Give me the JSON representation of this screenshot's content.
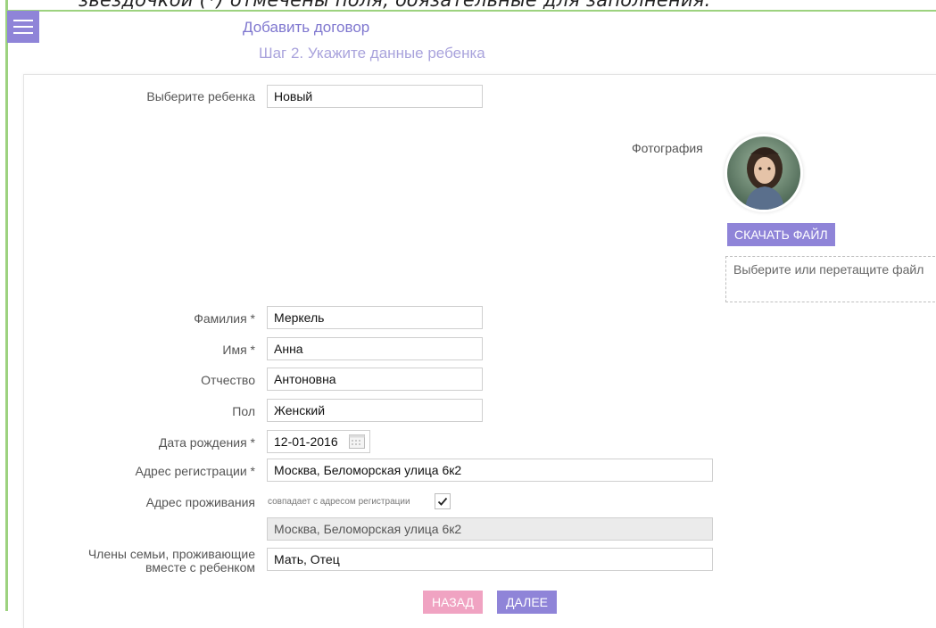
{
  "caption": "звездочкой (*) отмечены поля, обязательные для заполнения.",
  "header": {
    "title": "Добавить договор",
    "subtitle": "Шаг 2. Укажите данные ребенка"
  },
  "form": {
    "child_select": {
      "label": "Выберите ребенка",
      "value": "Новый"
    },
    "photo": {
      "label": "Фотография",
      "download_button": "СКАЧАТЬ ФАЙЛ",
      "dropzone": "Выберите или перетащите файл"
    },
    "surname": {
      "label": "Фамилия *",
      "value": "Меркель"
    },
    "name": {
      "label": "Имя *",
      "value": "Анна"
    },
    "patronymic": {
      "label": "Отчество",
      "value": "Антоновна"
    },
    "gender": {
      "label": "Пол",
      "value": "Женский"
    },
    "birthdate": {
      "label": "Дата рождения *",
      "value": "12-01-2016"
    },
    "reg_address": {
      "label": "Адрес регистрации *",
      "value": "Москва, Беломорская улица 6к2"
    },
    "living_address": {
      "label": "Адрес проживания",
      "same_as_reg": "совпадает с адресом регистрации",
      "value": "Москва, Беломорская улица 6к2",
      "checked": true
    },
    "family": {
      "label_line1": "Члены семьи, проживающие",
      "label_line2": "вместе с ребенком",
      "value": "Мать, Отец"
    }
  },
  "actions": {
    "back": "НАЗАД",
    "next": "ДАЛЕЕ"
  },
  "colors": {
    "accent": "#8f84d8",
    "back_button": "#f0a3c2",
    "frame": "#9dd27f"
  }
}
